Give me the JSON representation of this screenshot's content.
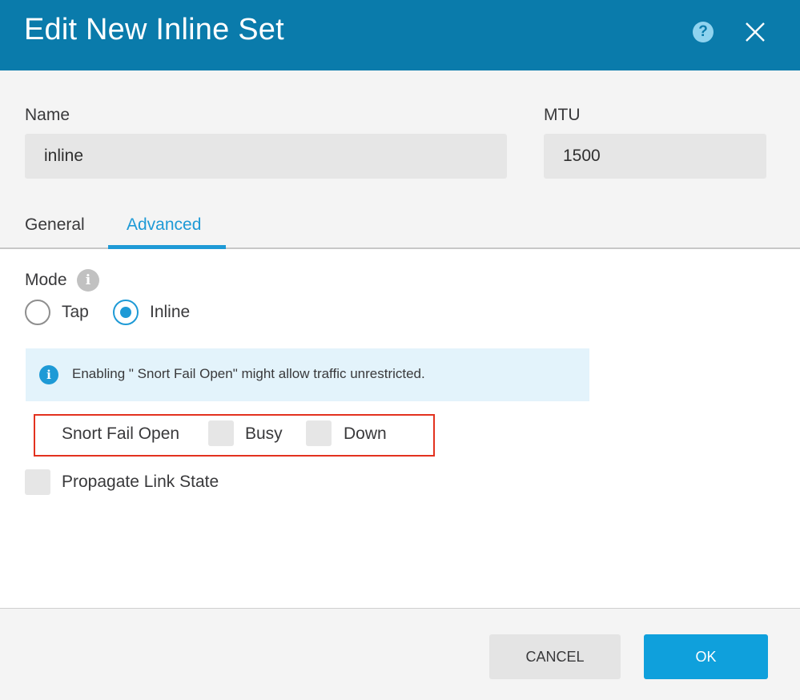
{
  "dialog": {
    "title": "Edit New Inline Set",
    "help_icon": "question-circle-icon",
    "close_icon": "close-x-icon"
  },
  "name_field": {
    "label": "Name",
    "value": "inline"
  },
  "mtu_field": {
    "label": "MTU",
    "value": "1500"
  },
  "tabs": [
    {
      "label": "General",
      "active": false
    },
    {
      "label": "Advanced",
      "active": true
    }
  ],
  "mode": {
    "label": "Mode",
    "info_icon": "info-icon",
    "options": [
      {
        "label": "Tap",
        "selected": false
      },
      {
        "label": "Inline",
        "selected": true
      }
    ]
  },
  "info_banner": {
    "icon": "info-icon",
    "text": "Enabling \" Snort Fail Open\"  might allow traffic unrestricted."
  },
  "snort_fail_open": {
    "label": "Snort Fail Open",
    "options": [
      {
        "label": "Busy",
        "checked": false
      },
      {
        "label": "Down",
        "checked": false
      }
    ]
  },
  "propagate_link_state": {
    "label": "Propagate Link State",
    "checked": false
  },
  "footer": {
    "cancel_label": "CANCEL",
    "ok_label": "OK"
  },
  "colors": {
    "header_bg": "#0a7bab",
    "accent": "#1e9ad6",
    "ok_button": "#0fa0dc",
    "highlight": "#e3321f"
  }
}
